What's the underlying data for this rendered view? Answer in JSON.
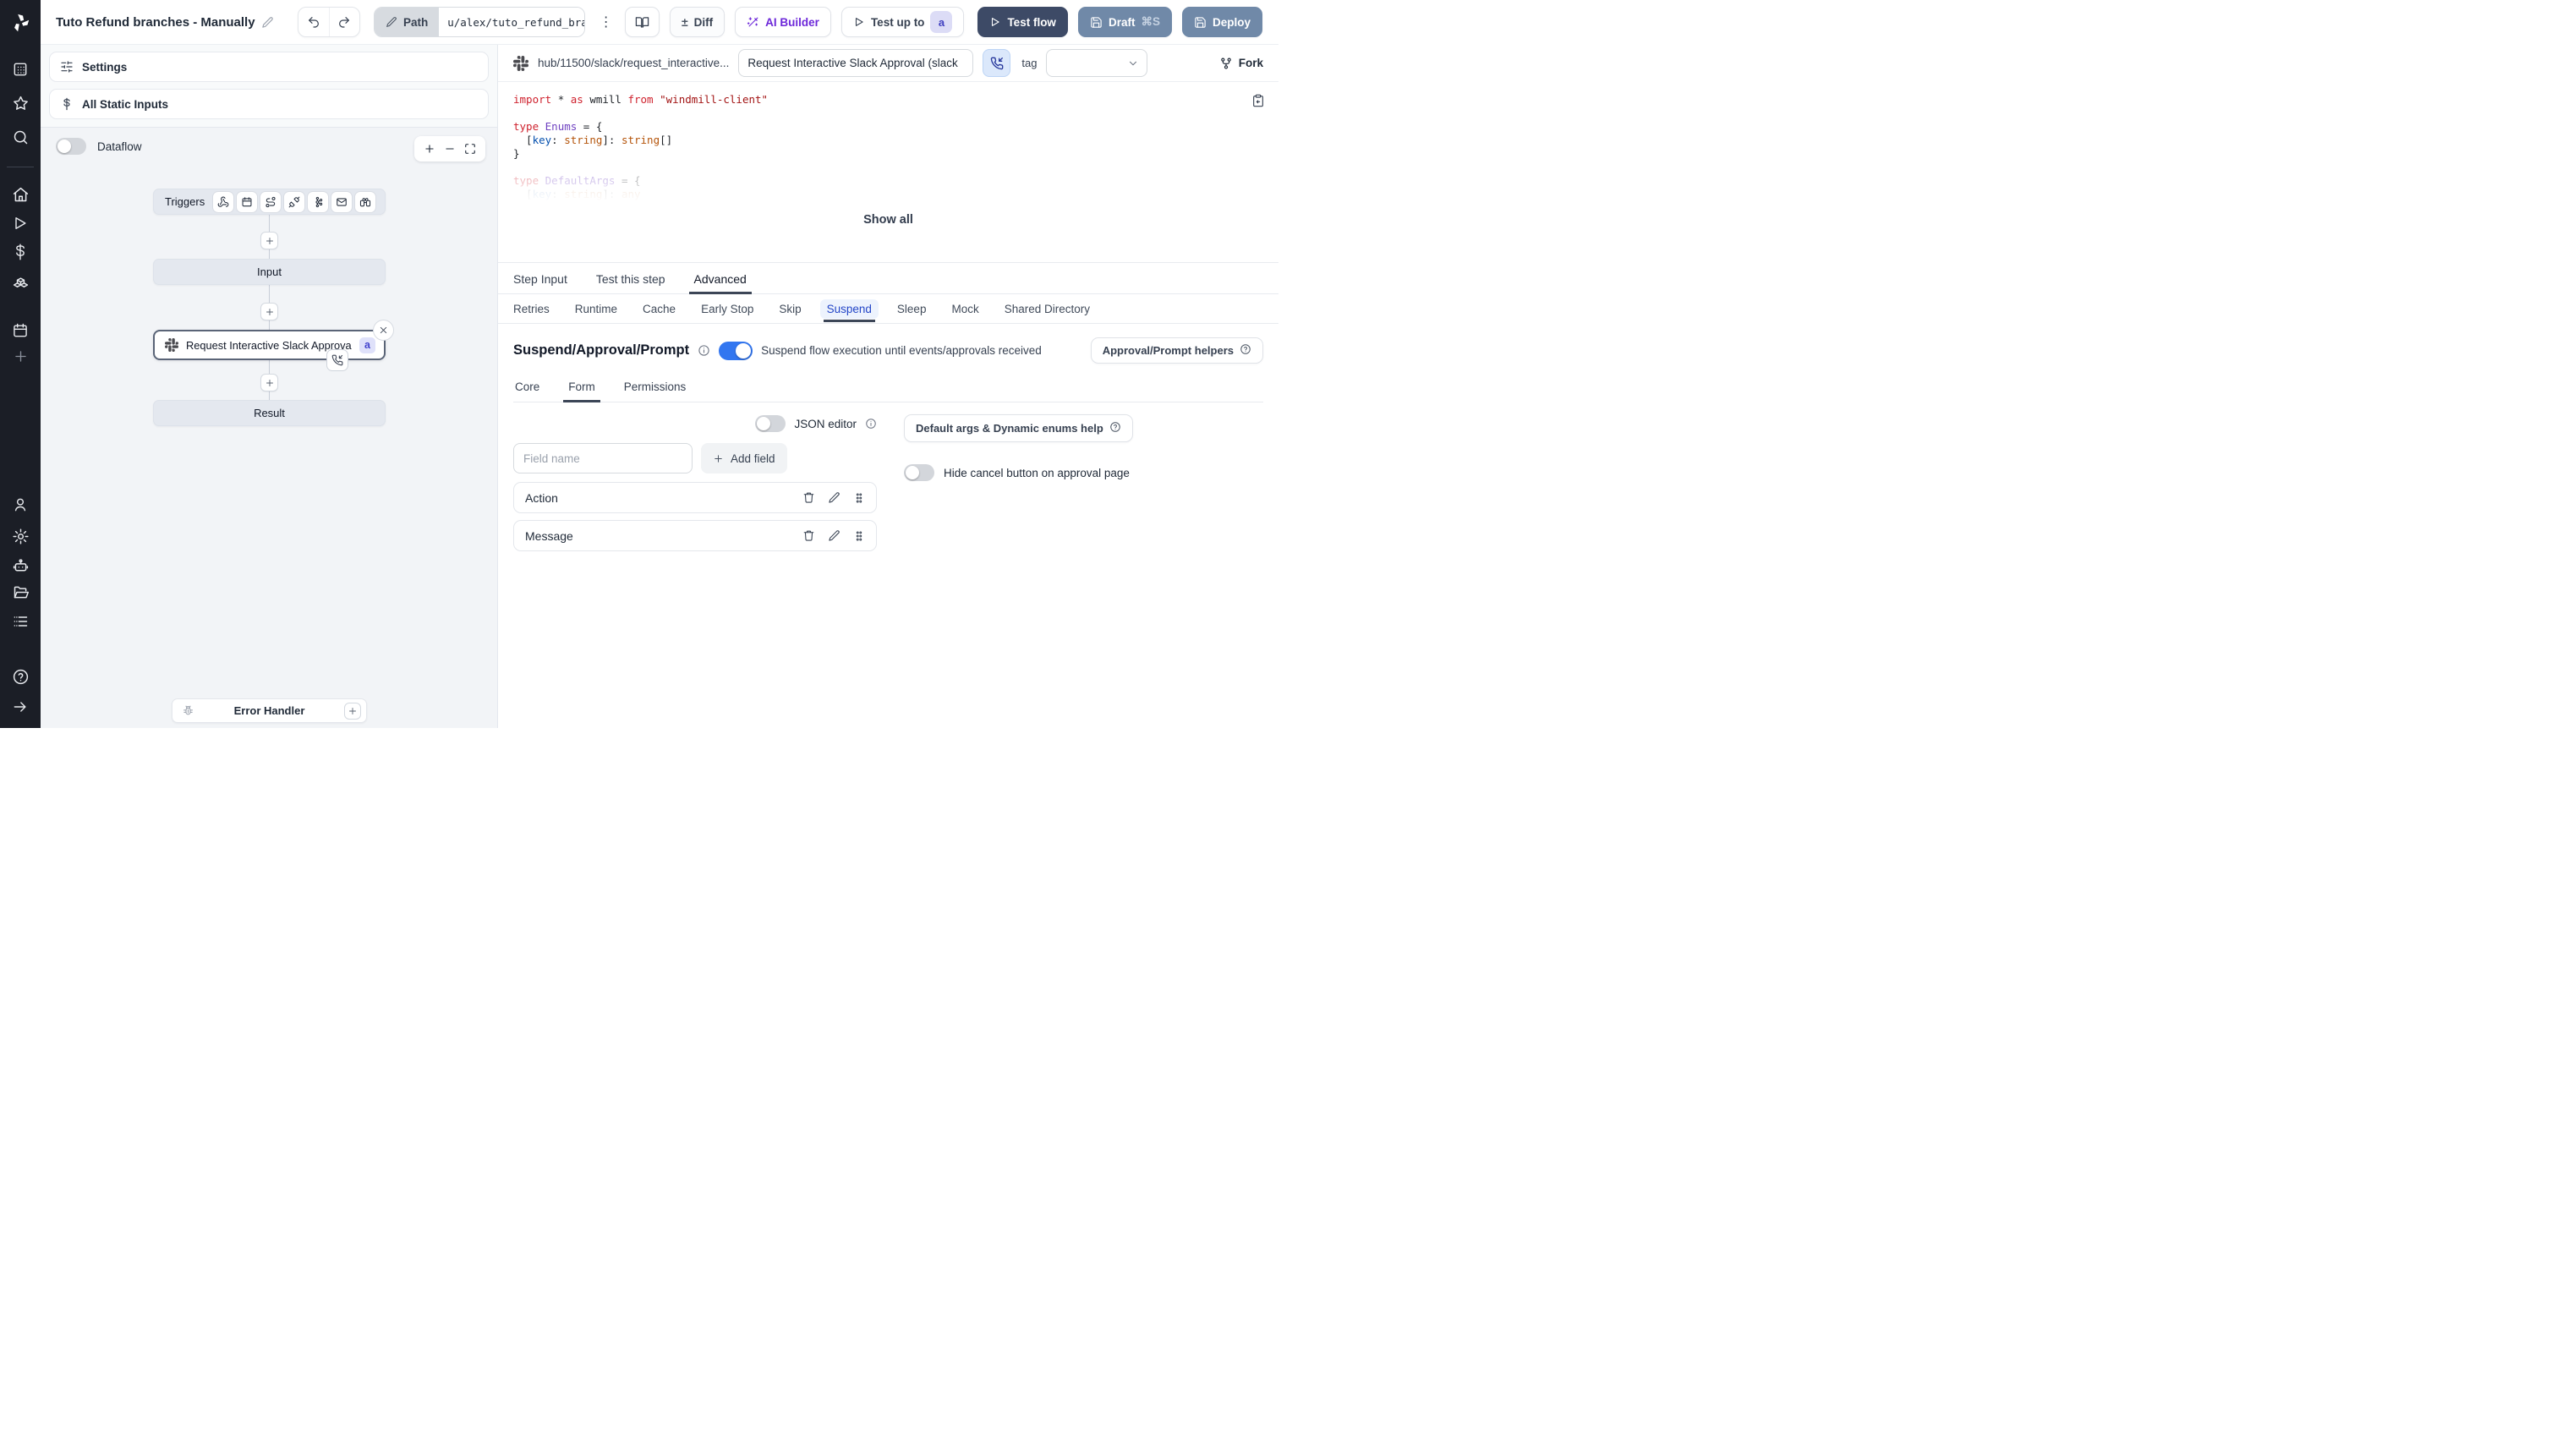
{
  "colors": {
    "accent_blue": "#3276f0",
    "dark_navy": "#3d4a66",
    "slate_button": "#7089a8",
    "indigo_badge_bg": "#dfe1fa",
    "indigo_badge_text": "#4343cd",
    "suspend_active": "#2446c7",
    "ai_purple": "#6d28d9"
  },
  "rail_icons": [
    "windmill-logo",
    "workspace",
    "favorites",
    "search",
    "home",
    "runs",
    "variables",
    "resources",
    "schedules",
    "add",
    "user",
    "settings",
    "workers",
    "folders",
    "apps",
    "help",
    "collapse"
  ],
  "header": {
    "title": "Tuto Refund branches - Manually",
    "path_label": "Path",
    "path_value": "u/alex/tuto_refund_branches__",
    "kebab": "⋮",
    "diff_symbol": "±",
    "diff_label": "Diff",
    "ai_builder_label": "AI Builder",
    "test_up_to_label": "Test up to",
    "test_up_to_badge": "a",
    "test_flow_label": "Test flow",
    "draft_label": "Draft",
    "draft_shortcut": "⌘S",
    "deploy_label": "Deploy"
  },
  "flow": {
    "settings_label": "Settings",
    "static_inputs_label": "All Static Inputs",
    "dataflow_label": "Dataflow",
    "triggers_label": "Triggers",
    "input_label": "Input",
    "step_label": "Request Interactive Slack Approval (...",
    "step_badge": "a",
    "result_label": "Result",
    "error_handler_label": "Error Handler"
  },
  "step_panel": {
    "hub_path": "hub/11500/slack/request_interactive...",
    "summary_value": "Request Interactive Slack Approval (slack",
    "tag_label": "tag",
    "fork_label": "Fork",
    "show_all_label": "Show all",
    "code_lines": [
      {
        "tokens": [
          [
            "import ",
            "kw"
          ],
          [
            "* ",
            "pl"
          ],
          [
            "as ",
            "kw"
          ],
          [
            "wmill ",
            "pl"
          ],
          [
            "from ",
            "kw"
          ],
          [
            "\"windmill-client\"",
            "str"
          ]
        ]
      },
      {
        "tokens": []
      },
      {
        "tokens": [
          [
            "type ",
            "kw"
          ],
          [
            "Enums ",
            "ty"
          ],
          [
            "= {",
            "pl"
          ]
        ]
      },
      {
        "tokens": [
          [
            "  [",
            "pl"
          ],
          [
            "key",
            "prop"
          ],
          [
            ": ",
            "pl"
          ],
          [
            "string",
            "bt"
          ],
          [
            "]: ",
            "pl"
          ],
          [
            "string",
            "bt"
          ],
          [
            "[]",
            "pl"
          ]
        ]
      },
      {
        "tokens": [
          [
            "}",
            "pl"
          ]
        ]
      },
      {
        "tokens": []
      },
      {
        "tokens": [
          [
            "type ",
            "kw"
          ],
          [
            "DefaultArgs ",
            "ty"
          ],
          [
            "= {",
            "pl"
          ]
        ],
        "fade": 1
      },
      {
        "tokens": [
          [
            "  [",
            "pl"
          ],
          [
            "key",
            "prop"
          ],
          [
            ": ",
            "pl"
          ],
          [
            "string",
            "bt"
          ],
          [
            "]: ",
            "pl"
          ],
          [
            "any",
            "bt"
          ]
        ],
        "fade": 2
      }
    ],
    "tabs": [
      "Step Input",
      "Test this step",
      "Advanced"
    ],
    "active_tab": "Advanced",
    "subtabs": [
      "Retries",
      "Runtime",
      "Cache",
      "Early Stop",
      "Skip",
      "Suspend",
      "Sleep",
      "Mock",
      "Shared Directory"
    ],
    "active_subtab": "Suspend",
    "suspend": {
      "heading": "Suspend/Approval/Prompt",
      "enabled_text": "Suspend flow execution until events/approvals received",
      "helpers_label": "Approval/Prompt helpers",
      "form_tabs": [
        "Core",
        "Form",
        "Permissions"
      ],
      "active_form_tab": "Form",
      "json_editor_label": "JSON editor",
      "field_name_placeholder": "Field name",
      "add_field_label": "Add field",
      "default_args_help_label": "Default args & Dynamic enums help",
      "hide_cancel_label": "Hide cancel button on approval page",
      "fields": [
        "Action",
        "Message"
      ]
    }
  }
}
